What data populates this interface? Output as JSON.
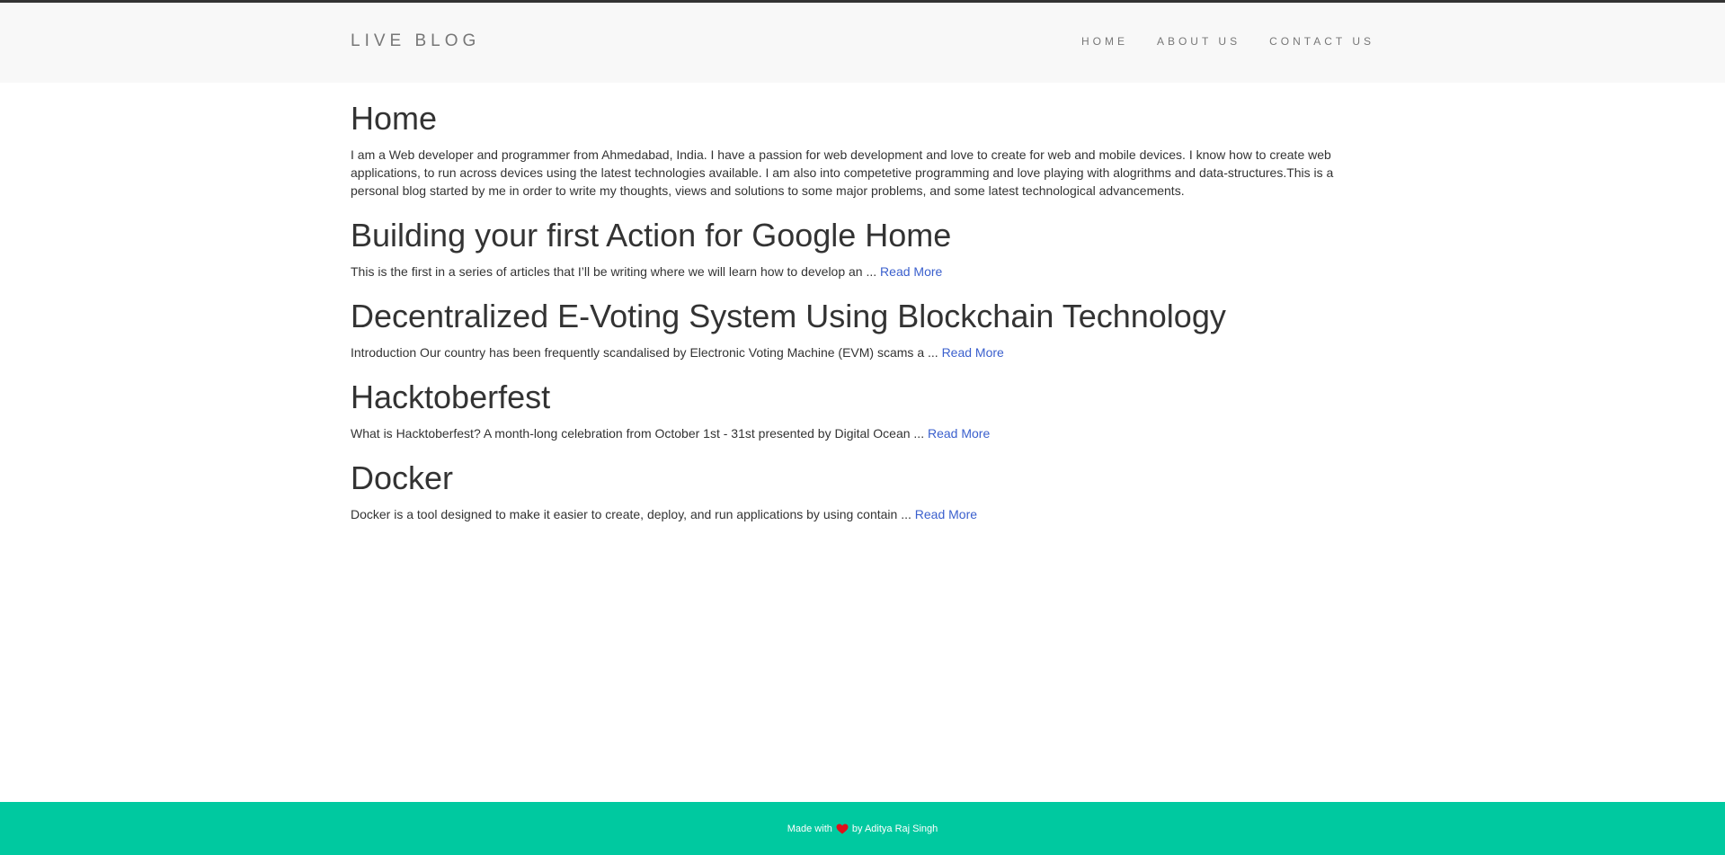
{
  "header": {
    "brand": "LIVE BLOG",
    "nav": [
      {
        "label": "HOME"
      },
      {
        "label": "ABOUT US"
      },
      {
        "label": "CONTACT US"
      }
    ]
  },
  "main": {
    "title": "Home",
    "intro": "I am a Web developer and programmer from Ahmedabad, India. I have a passion for web development and love to create for web and mobile devices. I know how to create web applications, to run across devices using the latest technologies available. I am also into competetive programming and love playing with alogrithms and data-structures.This is a personal blog started by me in order to write my thoughts, views and solutions to some major problems, and some latest technological advancements.",
    "posts": [
      {
        "title": "Building your first Action for Google Home",
        "excerpt": "This is the first in a series of articles that I’ll be writing where we will learn how to develop an ... ",
        "link": "Read More"
      },
      {
        "title": "Decentralized E-Voting System Using Blockchain Technology",
        "excerpt": "Introduction Our country has been frequently scandalised by Electronic Voting Machine (EVM) scams a ... ",
        "link": "Read More"
      },
      {
        "title": "Hacktoberfest",
        "excerpt": "What is Hacktoberfest? A month-long celebration from October 1st - 31st presented by Digital Ocean ... ",
        "link": "Read More"
      },
      {
        "title": "Docker",
        "excerpt": "Docker is a tool designed to make it easier to create, deploy, and run applications by using contain ... ",
        "link": "Read More"
      }
    ]
  },
  "footer": {
    "prefix": "Made with",
    "suffix": "by Aditya Raj Singh",
    "icon": "heart-icon",
    "accent_color": "#00c9a0",
    "heart_color": "#e0101a"
  }
}
